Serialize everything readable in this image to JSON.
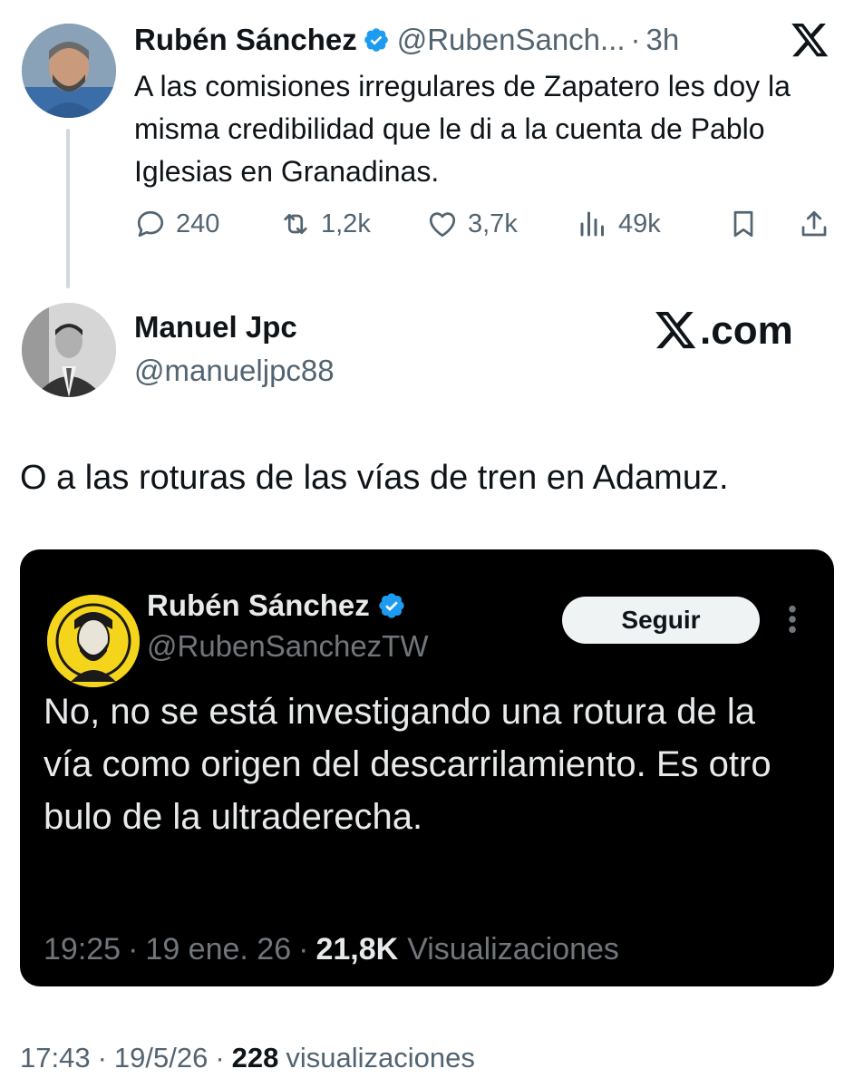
{
  "parent_tweet": {
    "author_name": "Rubén Sánchez",
    "author_handle": "@RubenSanch...",
    "separator": "·",
    "time": "3h",
    "text": "A las comisiones irregulares de Zapatero les doy la misma credibilidad que le di a la cuenta de Pablo Iglesias en Granadinas.",
    "stats": {
      "replies": "240",
      "reposts": "1,2k",
      "likes": "3,7k",
      "views": "49k"
    }
  },
  "main_tweet": {
    "author_name": "Manuel Jpc",
    "author_handle": "@manueljpc88",
    "watermark": ".com",
    "text": "O a las roturas de las vías de tren en Adamuz.",
    "footer": {
      "time": "17:43",
      "date": "19/5/26",
      "views_count": "228",
      "views_label": "visualizaciones"
    }
  },
  "embedded_tweet": {
    "author_name": "Rubén Sánchez",
    "author_handle": "@RubenSanchezTW",
    "follow_label": "Seguir",
    "text": "No, no se está investigando una rotura de la vía como origen del descarrilamiento. Es otro bulo de la ultraderecha.",
    "time": "19:25",
    "date": "19 ene. 26",
    "views_count": "21,8K",
    "views_label": "Visualizaciones"
  },
  "colors": {
    "text_primary": "#0f1419",
    "text_secondary": "#536471",
    "verified_blue": "#1d9bf0",
    "thread_line": "#cfd9de",
    "embed_background": "#000000",
    "embed_text": "#e7e9ea",
    "embed_secondary": "#71767b"
  },
  "icons": [
    "x-logo-icon",
    "verified-icon",
    "reply-icon",
    "repost-icon",
    "like-icon",
    "views-icon",
    "bookmark-icon",
    "share-icon",
    "more-icon"
  ]
}
